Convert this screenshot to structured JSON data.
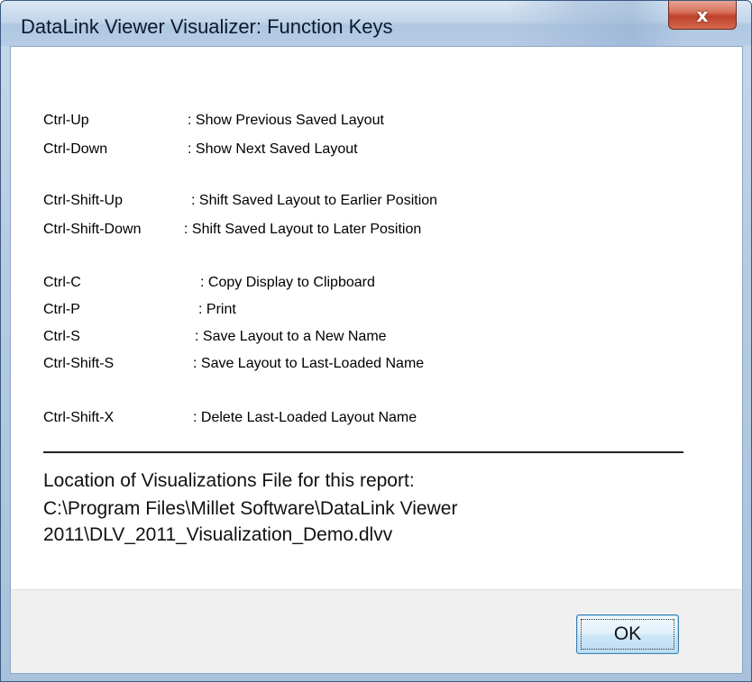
{
  "window": {
    "title": "DataLink Viewer Visualizer: Function Keys",
    "close_label": "x"
  },
  "shortcuts": [
    {
      "key": "Ctrl-Up",
      "desc": ": Show Previous Saved Layout"
    },
    {
      "key": "Ctrl-Down",
      "desc": ": Show Next Saved Layout"
    },
    {
      "key": "Ctrl-Shift-Up",
      "desc": ": Shift Saved Layout to Earlier Position"
    },
    {
      "key": "Ctrl-Shift-Down",
      "desc": ": Shift Saved Layout to Later Position"
    },
    {
      "key": "Ctrl-C",
      "desc": ": Copy Display to Clipboard"
    },
    {
      "key": "Ctrl-P",
      "desc": ": Print"
    },
    {
      "key": "Ctrl-S",
      "desc": ": Save Layout to a New Name"
    },
    {
      "key": "Ctrl-Shift-S",
      "desc": ": Save Layout to Last-Loaded Name"
    },
    {
      "key": "Ctrl-Shift-X",
      "desc": ": Delete Last-Loaded Layout Name"
    }
  ],
  "location": {
    "heading": "Location of Visualizations File for this report:",
    "path_line1": "C:\\Program Files\\Millet Software\\DataLink Viewer",
    "path_line2": "2011\\DLV_2011_Visualization_Demo.dlvv"
  },
  "footer": {
    "ok_label": "OK"
  },
  "colors": {
    "titlebar": "#c3d6ea",
    "close_button": "#c0402a",
    "footer": "#f0f0f0",
    "ok_button_border": "#3c7fb1"
  }
}
